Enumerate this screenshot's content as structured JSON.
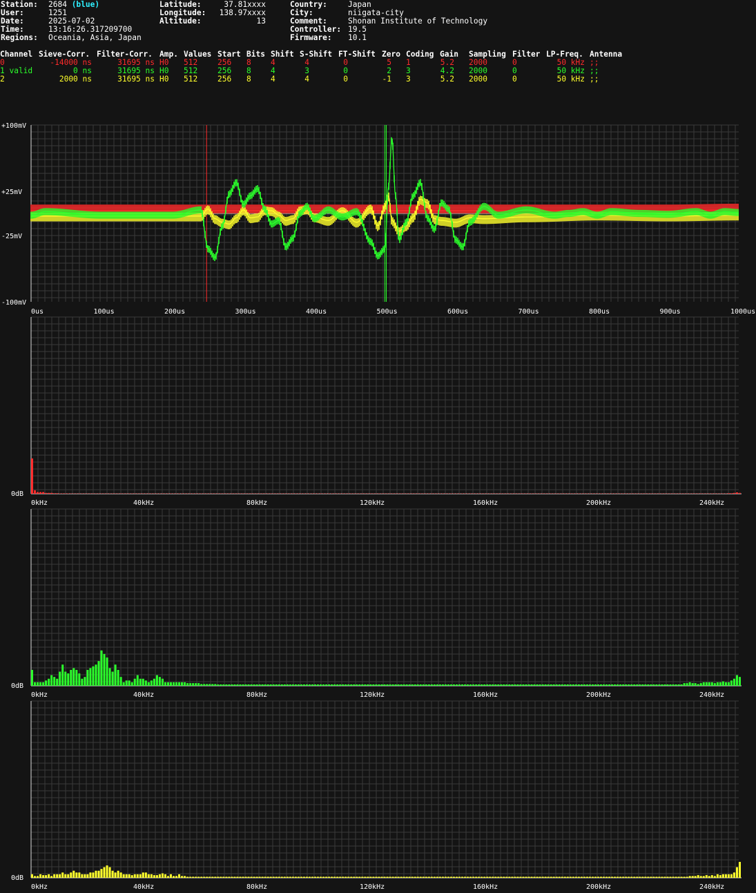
{
  "station_info": {
    "col1": [
      {
        "key": "Station:",
        "value": "2684",
        "extra": "(blue)"
      },
      {
        "key": "User:",
        "value": "1251"
      },
      {
        "key": "Date:",
        "value": "2025-07-02"
      },
      {
        "key": "Time:",
        "value": "13:16:26.317209700"
      },
      {
        "key": "Regions:",
        "value": "Oceania, Asia, Japan"
      }
    ],
    "col2": [
      {
        "key": "Latitude:",
        "value": "37.81xxxx"
      },
      {
        "key": "Longitude:",
        "value": "138.97xxxx"
      },
      {
        "key": "Altitude:",
        "value": "13"
      }
    ],
    "col3": [
      {
        "key": "Country:",
        "value": "Japan"
      },
      {
        "key": "City:",
        "value": "niigata-city"
      },
      {
        "key": "Comment:",
        "value": "Shonan Institute of Technology"
      },
      {
        "key": "Controller:",
        "value": "19.5"
      },
      {
        "key": "Firmware:",
        "value": "10.1"
      }
    ]
  },
  "channel_table": {
    "headers": [
      "Channel",
      "Sieve-Corr.",
      "Filter-Corr.",
      "Amp.",
      "Values",
      "Start",
      "Bits",
      "Shift",
      "S-Shift",
      "FT-Shift",
      "Zero",
      "Coding",
      "Gain",
      "Sampling",
      "Filter",
      "LP-Freq.",
      "Antenna"
    ],
    "rows": [
      [
        "0",
        "-14000 ns",
        "31695 ns",
        "H0",
        "512",
        "256",
        "8",
        "4",
        "4",
        "0",
        "5",
        "1",
        "5.2",
        "2000",
        "0",
        "50 kHz",
        ";;"
      ],
      [
        "1 valid",
        "0 ns",
        "31695 ns",
        "H0",
        "512",
        "256",
        "8",
        "4",
        "3",
        "0",
        "2",
        "3",
        "4.2",
        "2000",
        "0",
        "50 kHz",
        ";;"
      ],
      [
        "2",
        "2000 ns",
        "31695 ns",
        "H0",
        "512",
        "256",
        "8",
        "4",
        "4",
        "0",
        "-1",
        "3",
        "5.2",
        "2000",
        "0",
        "50 kHz",
        ";;"
      ]
    ],
    "colors": [
      "#ff2b2b",
      "#2bff2b",
      "#ffff2b"
    ]
  },
  "chart_data": [
    {
      "type": "line",
      "panel": "time-domain",
      "ylabels": [
        "+100mV",
        "+25mV",
        "-25mV",
        "-100mV"
      ],
      "ylim": [
        -100,
        100
      ],
      "xlim": [
        0,
        1000
      ],
      "xtick_labels": [
        "0us",
        "100us",
        "200us",
        "300us",
        "400us",
        "500us",
        "600us",
        "700us",
        "800us",
        "900us",
        "1000us"
      ],
      "xticks": [
        0,
        100,
        200,
        300,
        400,
        500,
        600,
        700,
        800,
        900,
        1000
      ],
      "grid": true,
      "markers": [
        {
          "x": 248,
          "color": "#ff2b2b"
        },
        {
          "x": 500,
          "color": "#2bff2b"
        }
      ],
      "series": [
        {
          "channel": "0",
          "color": "#ff2b2b",
          "noise": 5,
          "offset": 2,
          "x": [
            0,
            100,
            200,
            300,
            400,
            480,
            520,
            600,
            700,
            800,
            900,
            1000
          ],
          "y": [
            3,
            3,
            3,
            3,
            3,
            3,
            3,
            3,
            3,
            3,
            3,
            4
          ]
        },
        {
          "channel": "1",
          "color": "#2bff2b",
          "noise": 4,
          "offset": 0,
          "x": [
            0,
            20,
            100,
            200,
            240,
            250,
            260,
            270,
            280,
            290,
            300,
            310,
            320,
            330,
            340,
            350,
            360,
            370,
            380,
            390,
            400,
            420,
            440,
            460,
            480,
            490,
            500,
            505,
            510,
            515,
            520,
            530,
            540,
            550,
            560,
            570,
            580,
            590,
            600,
            610,
            620,
            640,
            660,
            700,
            740,
            760,
            780,
            800,
            820,
            860,
            900,
            940,
            960,
            980,
            1000
          ],
          "y": [
            -2,
            2,
            -2,
            -2,
            4,
            -40,
            -50,
            -15,
            22,
            35,
            10,
            20,
            28,
            5,
            -12,
            -8,
            -38,
            -28,
            0,
            8,
            -6,
            4,
            -4,
            2,
            -32,
            -48,
            -40,
            30,
            85,
            20,
            -30,
            -10,
            20,
            35,
            -5,
            -18,
            12,
            5,
            -30,
            -38,
            -10,
            8,
            -2,
            4,
            -2,
            0,
            2,
            -2,
            2,
            0,
            -1,
            2,
            -2,
            2,
            1
          ]
        },
        {
          "channel": "2",
          "color": "#ffff2b",
          "noise": 5,
          "offset": -1,
          "x": [
            0,
            100,
            200,
            240,
            250,
            260,
            270,
            280,
            290,
            300,
            310,
            320,
            330,
            340,
            350,
            360,
            370,
            380,
            390,
            400,
            420,
            440,
            460,
            480,
            490,
            500,
            505,
            510,
            520,
            530,
            540,
            550,
            560,
            570,
            580,
            600,
            620,
            640,
            700,
            800,
            900,
            1000
          ],
          "y": [
            -3,
            -3,
            -3,
            -3,
            5,
            -6,
            -10,
            -12,
            -5,
            4,
            -5,
            -4,
            4,
            3,
            -2,
            -8,
            -6,
            4,
            5,
            -4,
            -8,
            3,
            -10,
            6,
            -14,
            8,
            20,
            -8,
            -20,
            -14,
            -4,
            16,
            12,
            -6,
            -8,
            -10,
            -5,
            -6,
            -4,
            -2,
            -3,
            -2
          ]
        }
      ]
    },
    {
      "type": "bar",
      "panel": "spectrum-channel-0",
      "color": "#ff2b2b",
      "ylabel_text": "0dB",
      "xtick_labels": [
        "0kHz",
        "40kHz",
        "80kHz",
        "120kHz",
        "160kHz",
        "200kHz",
        "240kHz"
      ],
      "xlim": [
        0,
        250
      ],
      "ylim": [
        0,
        100
      ],
      "bins": 256,
      "values_head": [
        20,
        2,
        1,
        1,
        1,
        0.5,
        0.5,
        0.5,
        0.3,
        0.3,
        0.2,
        0.2,
        0.2,
        0.2
      ],
      "values_tail": [
        0.3,
        0.3,
        0.5,
        0.8,
        0.5
      ],
      "baseline_value": 0.15
    },
    {
      "type": "bar",
      "panel": "spectrum-channel-1",
      "color": "#2bff2b",
      "ylabel_text": "0dB",
      "xtick_labels": [
        "0kHz",
        "40kHz",
        "80kHz",
        "120kHz",
        "160kHz",
        "200kHz",
        "240kHz"
      ],
      "xlim": [
        0,
        250
      ],
      "ylim": [
        0,
        100
      ],
      "bins": 256,
      "values_head": [
        9,
        2,
        2,
        2,
        2,
        3,
        4,
        6,
        5,
        4,
        8,
        12,
        8,
        7,
        9,
        10,
        9,
        7,
        4,
        5,
        9,
        10,
        11,
        12,
        14,
        20,
        18,
        16,
        10,
        8,
        12,
        9,
        5,
        2,
        3,
        3,
        2,
        4,
        6,
        4,
        4,
        3,
        2,
        3,
        4,
        6,
        5,
        4,
        2,
        2,
        2,
        2,
        2,
        2,
        2,
        2,
        1.5,
        1.5,
        1.5,
        1.5,
        1.5,
        1,
        1,
        1,
        1,
        1,
        1,
        0.8
      ],
      "values_tail": [
        1.5,
        1.5,
        2,
        1.5,
        1.5,
        1,
        1.5,
        2,
        2,
        2,
        2,
        1.5,
        2,
        2,
        2.5,
        2,
        2,
        3,
        4,
        6,
        5
      ],
      "baseline_value": 0.8
    },
    {
      "type": "bar",
      "panel": "spectrum-channel-2",
      "color": "#ffff2b",
      "ylabel_text": "0dB",
      "xtick_labels": [
        "0kHz",
        "40kHz",
        "80kHz",
        "120kHz",
        "160kHz",
        "200kHz",
        "240kHz"
      ],
      "xlim": [
        0,
        250
      ],
      "ylim": [
        0,
        100
      ],
      "bins": 256,
      "values_head": [
        2,
        1,
        1,
        2,
        1.5,
        1.5,
        2,
        1,
        2,
        2,
        2,
        3,
        2,
        2,
        3,
        4,
        3,
        3,
        2,
        2,
        2,
        3,
        3,
        4,
        4,
        5,
        6,
        7,
        6,
        4,
        3,
        4,
        3,
        2,
        2,
        2,
        1.5,
        2,
        2,
        2,
        3,
        3,
        2,
        2,
        1.5,
        1.5,
        2,
        2.5,
        2,
        1,
        2,
        1,
        1,
        2,
        1,
        1
      ],
      "values_tail": [
        1,
        1,
        1,
        1.5,
        1,
        1,
        1.5,
        1,
        1.5,
        1,
        2,
        1.5,
        2,
        2,
        2,
        2,
        3,
        6,
        9
      ],
      "baseline_value": 0.6
    }
  ]
}
